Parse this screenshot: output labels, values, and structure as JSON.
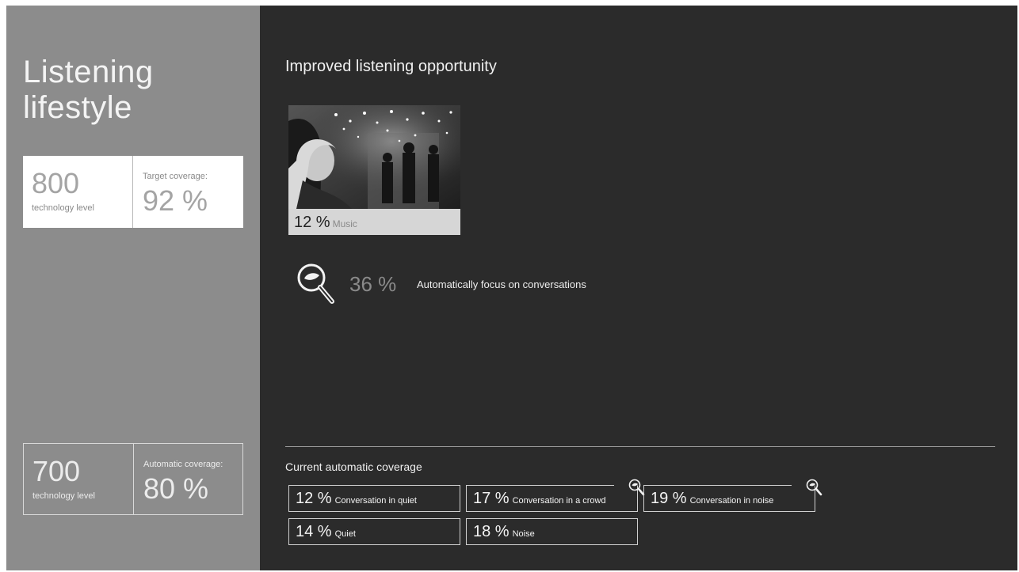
{
  "sidebar": {
    "title": "Listening\nlifestyle",
    "upper": {
      "tech_value": "800",
      "tech_label": "technology level",
      "coverage_label": "Target coverage:",
      "coverage_value": "92 %"
    },
    "lower": {
      "tech_value": "700",
      "tech_label": "technology level",
      "coverage_label": "Automatic coverage:",
      "coverage_value": "80 %"
    }
  },
  "main": {
    "title": "Improved listening opportunity",
    "music": {
      "pct": "12 %",
      "label": "Music"
    },
    "focus": {
      "pct": "36 %",
      "label": "Automatically focus on conversations",
      "icon": "magnifier-speech-icon"
    },
    "coverage_title": "Current automatic coverage",
    "coverage_items": [
      {
        "pct": "12 %",
        "label": "Conversation in quiet"
      },
      {
        "pct": "17 %",
        "label": "Conversation in a crowd",
        "icon": "magnifier-speech-icon"
      },
      {
        "pct": "19 %",
        "label": "Conversation in noise",
        "icon": "magnifier-speech-icon"
      },
      {
        "pct": "14 %",
        "label": "Quiet"
      },
      {
        "pct": "18 %",
        "label": "Noise"
      }
    ]
  },
  "colors": {
    "panel": "#2b2b2b",
    "sidebar": "#8c8c8c",
    "text_light": "#f4f4f4",
    "muted_value": "#a4a4a4"
  }
}
